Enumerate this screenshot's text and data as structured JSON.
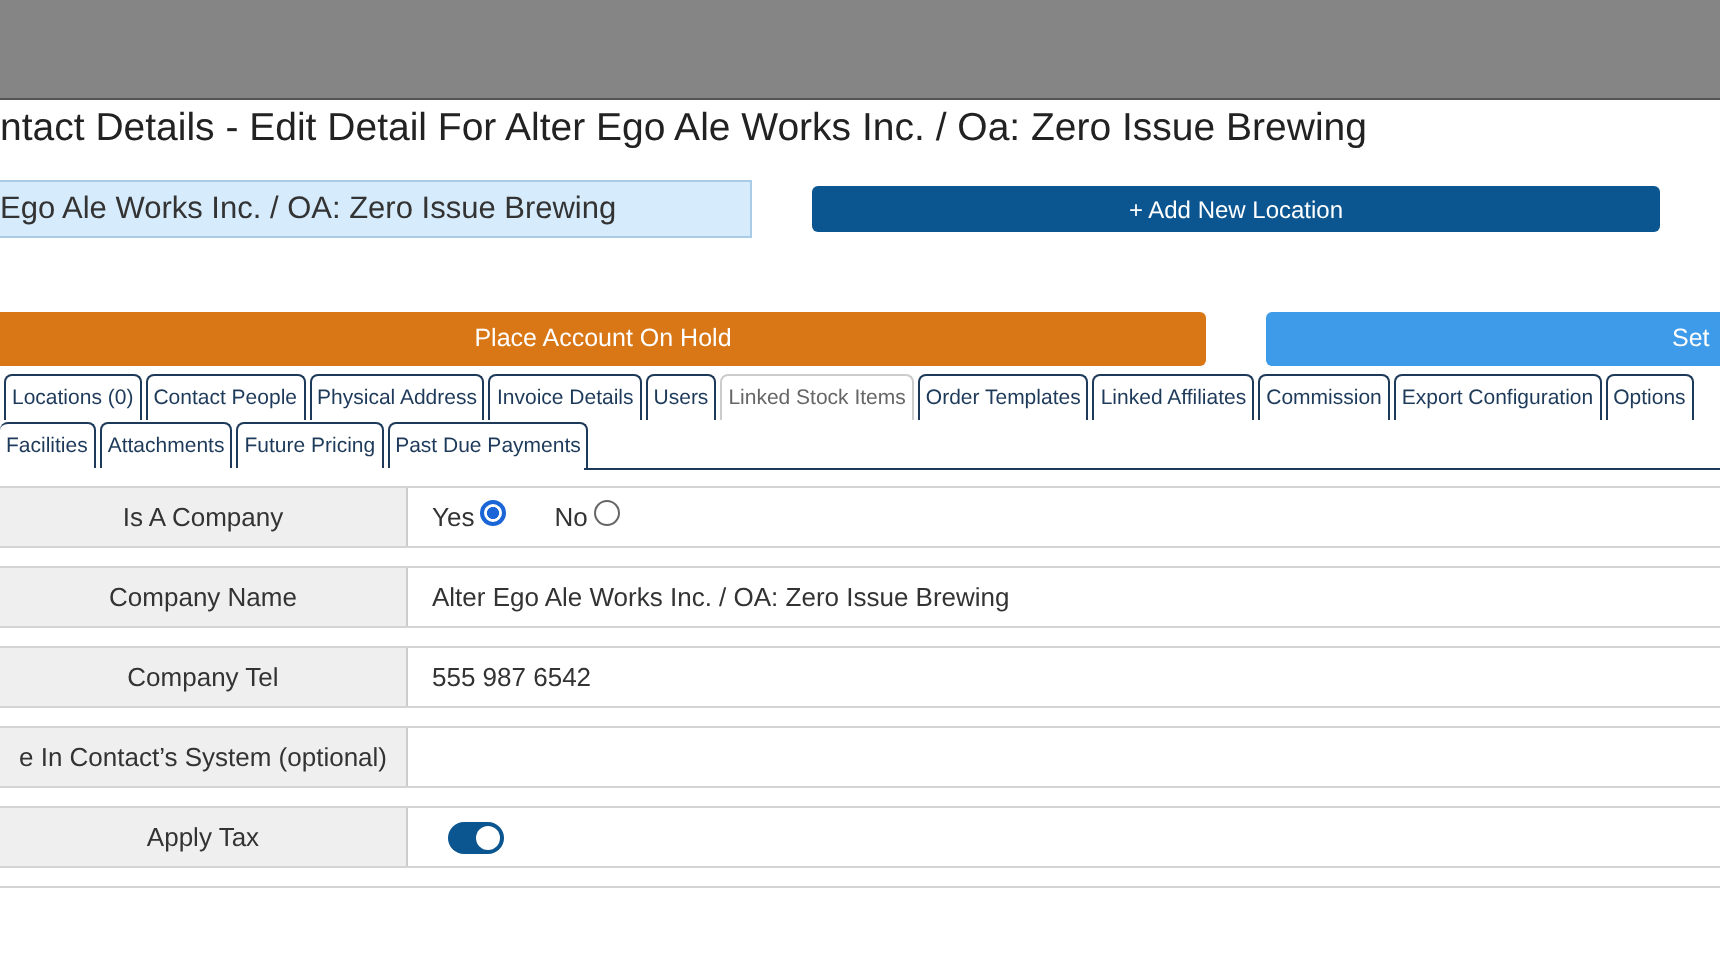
{
  "title": "ntact Details - Edit Detail For Alter Ego Ale Works Inc. / Oa: Zero Issue Brewing",
  "account_field": {
    "value": "Ego Ale Works Inc. / OA: Zero Issue Brewing"
  },
  "buttons": [
    {
      "kind": "dark",
      "label": "+ Add New Location"
    },
    {
      "kind": "orange",
      "label": "Place Account On Hold"
    },
    {
      "kind": "light",
      "label": "Set"
    }
  ],
  "tab_rows": [
    [
      {
        "label": "Locations (0)",
        "selected": false
      },
      {
        "label": "Contact People",
        "selected": false
      },
      {
        "label": "Physical Address",
        "selected": false
      },
      {
        "label": "Invoice Details",
        "selected": false
      },
      {
        "label": "Users",
        "selected": false
      },
      {
        "label": "Linked Stock Items",
        "selected": true
      },
      {
        "label": "Order Templates",
        "selected": false
      },
      {
        "label": "Linked Affiliates",
        "selected": false
      },
      {
        "label": "Commission",
        "selected": false
      },
      {
        "label": "Export Configuration",
        "selected": false
      },
      {
        "label": "Options",
        "selected": false
      }
    ],
    [
      {
        "label": "Facilities",
        "selected": false
      },
      {
        "label": "Attachments",
        "selected": false
      },
      {
        "label": "Future Pricing",
        "selected": false
      },
      {
        "label": "Past Due Payments",
        "selected": false
      }
    ]
  ],
  "fields": [
    {
      "kind": "radio",
      "label": "Is A Company",
      "options": [
        {
          "label": "Yes",
          "selected": true
        },
        {
          "label": "No",
          "selected": false
        }
      ]
    },
    {
      "kind": "text",
      "label": "Company Name",
      "value": "Alter Ego Ale Works Inc. / OA: Zero Issue Brewing"
    },
    {
      "kind": "text",
      "label": "Company Tel",
      "value": "555 987 6542"
    },
    {
      "kind": "text",
      "label": "e In Contact’s System (optional)"
    },
    {
      "kind": "toggle",
      "label": "Apply Tax",
      "on": true
    }
  ]
}
